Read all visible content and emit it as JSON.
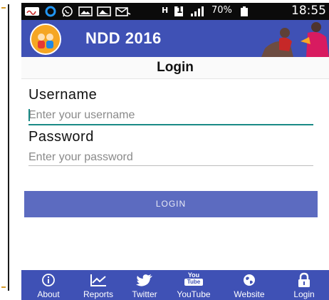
{
  "app": {
    "title": "NDD 2016"
  },
  "status_bar": {
    "battery": "70%",
    "time": "18:55",
    "sim": "1"
  },
  "login": {
    "title": "Login",
    "username_label": "Username",
    "username_placeholder": "Enter your username",
    "password_label": "Password",
    "password_placeholder": "Enter your password",
    "button_label": "LOGIN"
  },
  "bottom_nav": {
    "items": [
      {
        "label": "About",
        "icon": "info-icon"
      },
      {
        "label": "Reports",
        "icon": "chart-icon"
      },
      {
        "label": "Twitter",
        "icon": "twitter-icon"
      },
      {
        "label": "YouTube",
        "icon": "youtube-icon",
        "icon_text_top": "You",
        "icon_text_bottom": "Tube"
      },
      {
        "label": "Website",
        "icon": "globe-icon"
      },
      {
        "label": "Login",
        "icon": "lock-icon"
      }
    ]
  },
  "colors": {
    "primary": "#3f51b5",
    "button": "#5c6bc0",
    "accent": "#1a8a86",
    "status_bar": "#0b0b0b"
  }
}
